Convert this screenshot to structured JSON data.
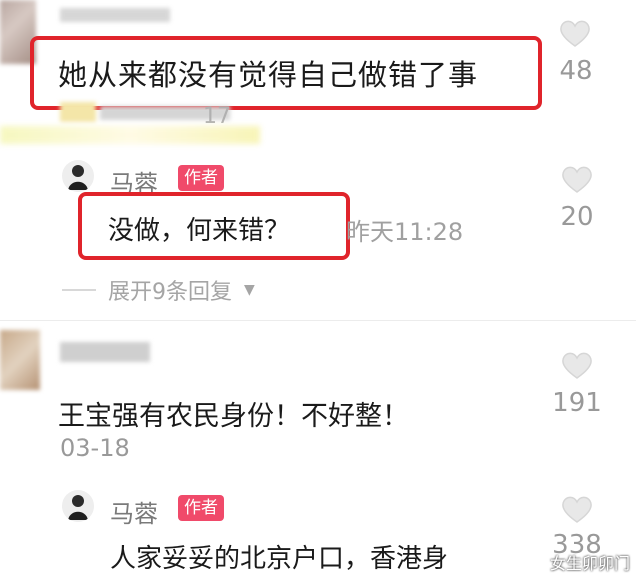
{
  "comments": [
    {
      "text": "她从来都没有觉得自己做错了事",
      "meta_suffix": "17",
      "likes": "48"
    },
    {
      "text": "王宝强有农民身份！不好整！",
      "date": "03-18",
      "likes": "191"
    }
  ],
  "replies": [
    {
      "author": "马蓉",
      "badge": "作者",
      "text": "没做，何来错？",
      "time": "昨天11:28",
      "likes": "20",
      "expand": "展开9条回复"
    },
    {
      "author": "马蓉",
      "badge": "作者",
      "text": "人家妥妥的北京户口，香港身",
      "likes": "338"
    }
  ],
  "watermark": "女生卯卯门",
  "colors": {
    "highlight_box": "#e0242b",
    "author_badge": "#f04a6a"
  },
  "icons": [
    "heart-outline-icon",
    "chevron-down-icon",
    "avatar-icon"
  ]
}
